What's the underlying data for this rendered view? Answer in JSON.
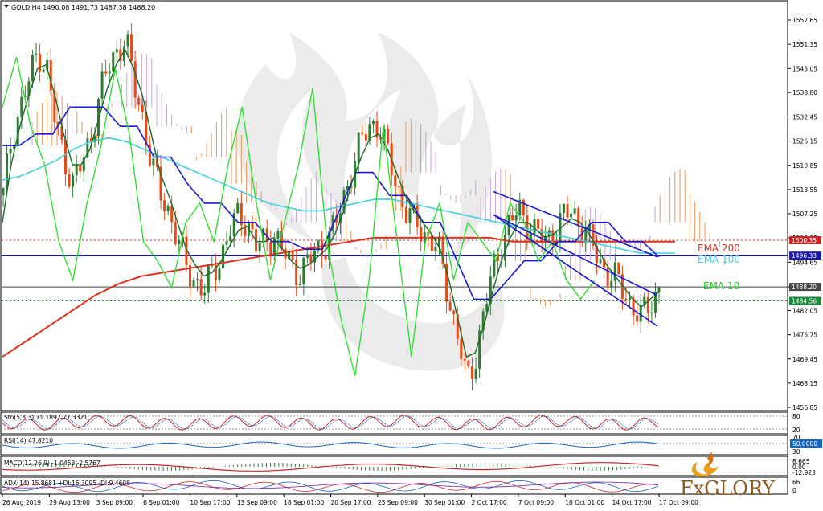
{
  "chart_data": {
    "type": "candlestick",
    "symbol_header": "GOLD,H4  1490.08 1491.73 1487.38 1488.20",
    "price_axis": {
      "ticks": [
        "1557.65",
        "1551.35",
        "1545.05",
        "1538.80",
        "1532.45",
        "1526.15",
        "1519.85",
        "1513.55",
        "1507.25",
        "1500.95",
        "1494.65",
        "1488.20",
        "1482.05",
        "1475.75",
        "1469.45",
        "1463.15",
        "1456.85"
      ],
      "range": [
        1456.85,
        1557.65
      ]
    },
    "time_axis": {
      "ticks": [
        "26 Aug 2019",
        "29 Aug 13:00",
        "3 Sep 09:00",
        "6 Sep 01:00",
        "10 Sep 17:00",
        "13 Sep 09:00",
        "18 Sep 01:00",
        "20 Sep 17:00",
        "25 Sep 09:00",
        "30 Sep 01:00",
        "2 Oct 17:00",
        "7 Oct 09:00",
        "10 Oct 01:00",
        "14 Oct 17:00",
        "17 Oct 09:00"
      ]
    },
    "price_labels": [
      {
        "text": "1500.35",
        "price": 1500.35,
        "color": "#c62828"
      },
      {
        "text": "1496.33",
        "price": 1496.33,
        "color": "#1a1aa8"
      },
      {
        "text": "1488.20",
        "price": 1488.2,
        "color": "#444444"
      },
      {
        "text": "1484.56",
        "price": 1484.56,
        "color": "#1a8a3a"
      }
    ],
    "legend": {
      "ema200": {
        "text": "EMA 200",
        "color": "#e0301e"
      },
      "ema100": {
        "text": "EMA 100",
        "color": "#40d0e0"
      },
      "ema10": {
        "text": "EMA 10",
        "color": "#22cc22"
      }
    },
    "series": {
      "close_path": [
        1512,
        1528,
        1535,
        1542,
        1550,
        1545,
        1530,
        1522,
        1515,
        1520,
        1527,
        1538,
        1545,
        1550,
        1553,
        1540,
        1532,
        1520,
        1512,
        1508,
        1500,
        1493,
        1490,
        1487,
        1492,
        1497,
        1503,
        1507,
        1505,
        1498,
        1500,
        1502,
        1497,
        1494,
        1492,
        1495,
        1498,
        1500,
        1504,
        1512,
        1520,
        1526,
        1531,
        1530,
        1522,
        1515,
        1508,
        1505,
        1503,
        1500,
        1496,
        1485,
        1475,
        1463,
        1470,
        1482,
        1492,
        1500,
        1505,
        1508,
        1505,
        1502,
        1500,
        1503,
        1506,
        1508,
        1505,
        1500,
        1496,
        1492,
        1490,
        1487,
        1483,
        1480,
        1484,
        1488
      ],
      "ema10_path": [
        1505,
        1520,
        1530,
        1538,
        1545,
        1546,
        1538,
        1528,
        1520,
        1520,
        1524,
        1532,
        1540,
        1546,
        1550,
        1545,
        1538,
        1528,
        1518,
        1512,
        1505,
        1498,
        1494,
        1491,
        1492,
        1495,
        1499,
        1503,
        1504,
        1500,
        1500,
        1501,
        1498,
        1495,
        1493,
        1494,
        1496,
        1498,
        1502,
        1508,
        1516,
        1522,
        1527,
        1528,
        1524,
        1518,
        1512,
        1508,
        1505,
        1502,
        1498,
        1490,
        1480,
        1470,
        1471,
        1478,
        1487,
        1495,
        1501,
        1505,
        1505,
        1503,
        1501,
        1502,
        1504,
        1506,
        1505,
        1502,
        1498,
        1494,
        1491,
        1488,
        1485,
        1483,
        1485,
        1487
      ],
      "ema100_path": [
        1516,
        1517,
        1519,
        1521,
        1524,
        1526,
        1527,
        1526,
        1524,
        1522,
        1520,
        1518,
        1516,
        1514,
        1512,
        1510,
        1509,
        1508,
        1508,
        1509,
        1510,
        1511,
        1511,
        1510,
        1509,
        1508,
        1507,
        1506,
        1505,
        1504,
        1503,
        1502,
        1501,
        1500,
        1499,
        1498,
        1497,
        1497,
        1497
      ],
      "ema200_path": [
        1470,
        1474,
        1478,
        1482,
        1486,
        1489,
        1491,
        1492,
        1493,
        1494,
        1495,
        1496,
        1497,
        1498,
        1499,
        1500,
        1501,
        1501,
        1501,
        1501,
        1501,
        1501,
        1500,
        1500,
        1500,
        1500,
        1500,
        1500,
        1500,
        1500
      ],
      "kijun_path": [
        1525,
        1525,
        1528,
        1528,
        1535,
        1535,
        1535,
        1530,
        1530,
        1522,
        1522,
        1515,
        1510,
        1510,
        1505,
        1505,
        1500,
        1500,
        1498,
        1498,
        1508,
        1518,
        1518,
        1512,
        1512,
        1505,
        1505,
        1495,
        1485,
        1485,
        1490,
        1495,
        1495,
        1500,
        1500,
        1505,
        1505,
        1500,
        1500,
        1496
      ],
      "chikou_path": [
        1535,
        1548,
        1530,
        1520,
        1500,
        1490,
        1510,
        1525,
        1545,
        1528,
        1500,
        1495,
        1488,
        1505,
        1510,
        1500,
        1520,
        1535,
        1510,
        1490,
        1505,
        1520,
        1540,
        1500,
        1480,
        1465,
        1490,
        1530,
        1500,
        1470,
        1500,
        1510,
        1490,
        1505,
        1500,
        1495,
        1510,
        1505,
        1495,
        1500,
        1490,
        1485,
        1490
      ],
      "channel_upper": [
        [
          1513,
          1515
        ],
        [
          1496,
          1494
        ]
      ],
      "channel_lower": [
        [
          1507,
          1509
        ],
        [
          1478,
          1476
        ]
      ]
    }
  },
  "indicators": {
    "stoch": {
      "label": "Sto(5,3,3) 71.1892 77.3321",
      "levels": [
        "80",
        "20"
      ]
    },
    "rsi": {
      "label": "RSI(14) 47.8210",
      "value_box": "50.0000",
      "levels": [
        "70",
        "30"
      ]
    },
    "macd": {
      "label": "MACD(12,26,9) -1.0453 -2.5767",
      "levels": [
        "8.665",
        "0.00",
        "-12.923"
      ]
    },
    "adx": {
      "label": "ADX(14) 15.8681 +DI:16.3095 -DI:9.4608",
      "levels": [
        "66",
        "0"
      ]
    }
  },
  "brand": {
    "logo_text": "FxGLORY"
  }
}
